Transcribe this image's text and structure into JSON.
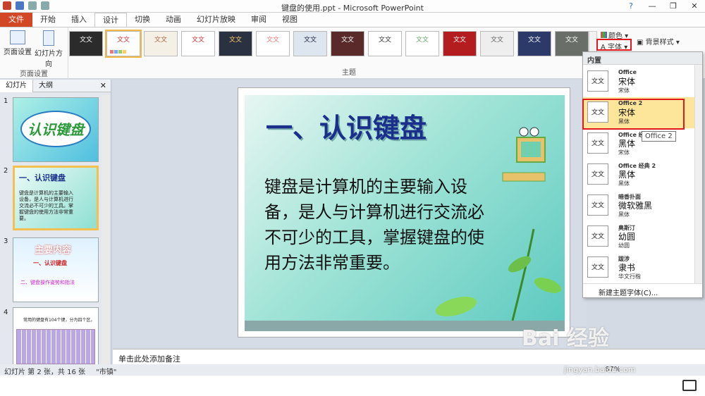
{
  "window": {
    "title": "键盘的使用.ppt - Microsoft PowerPoint",
    "help": "?",
    "min": "—",
    "max": "❐",
    "close": "✕"
  },
  "tabs": [
    "文件",
    "开始",
    "插入",
    "设计",
    "切换",
    "动画",
    "幻灯片放映",
    "审阅",
    "视图"
  ],
  "ribbon": {
    "page_setup": "页面设置",
    "orientation": "幻灯片方向",
    "group_page": "页面设置",
    "group_theme": "主题",
    "theme_text": "文文",
    "colors": "颜色",
    "fonts": "字体",
    "bg_style": "背景样式"
  },
  "accent": "#d24726",
  "panel": {
    "tab_slides": "幻灯片",
    "tab_outline": "大纲",
    "close": "✕"
  },
  "slides": [
    {
      "num": "1",
      "title": "认识键盘"
    },
    {
      "num": "2",
      "title": "一、认识键盘",
      "text": "键盘是计算机的主要输入设备，是人与计算机进行交流必不可少的工具。掌握键盘的使用方法非常重要。"
    },
    {
      "num": "3",
      "title": "主要内容",
      "line1": "一、认识键盘",
      "line2": "二、键盘操作姿势和指法"
    },
    {
      "num": "4",
      "text": "常用的键盘有104个键，分为四个区。"
    }
  ],
  "current_slide": {
    "title": "一、认识键盘",
    "body": "键盘是计算机的主要输入设备，是人与计算机进行交流必不可少的工具，掌握键盘的使用方法非常重要。"
  },
  "notes": "单击此处添加备注",
  "status": {
    "slide_info": "幻灯片 第 2 张，共 16 张",
    "theme": "\"市镇\"",
    "zoom": "67%"
  },
  "dropdown": {
    "header": "内置",
    "items": [
      {
        "name": "Office",
        "f1": "宋体",
        "f2": "宋体"
      },
      {
        "name": "Office 2",
        "f1": "宋体",
        "f2": "黑体"
      },
      {
        "name": "Office 经典",
        "f1": "黑体",
        "f2": "宋体"
      },
      {
        "name": "Office 经典 2",
        "f1": "黑体",
        "f2": "黑体"
      },
      {
        "name": "暗香扑面",
        "f1": "微软雅黑",
        "f2": "黑体"
      },
      {
        "name": "奥斯汀",
        "f1": "幼圆",
        "f2": "幼圆"
      },
      {
        "name": "跋涉",
        "f1": "隶书",
        "f2": "华文行楷"
      }
    ],
    "preview": "文文",
    "footer": "新建主题字体(C)..."
  },
  "tooltip": "Office 2",
  "watermark": {
    "brand": "Bai 经验",
    "sub": "jingyan.baidu.com"
  }
}
